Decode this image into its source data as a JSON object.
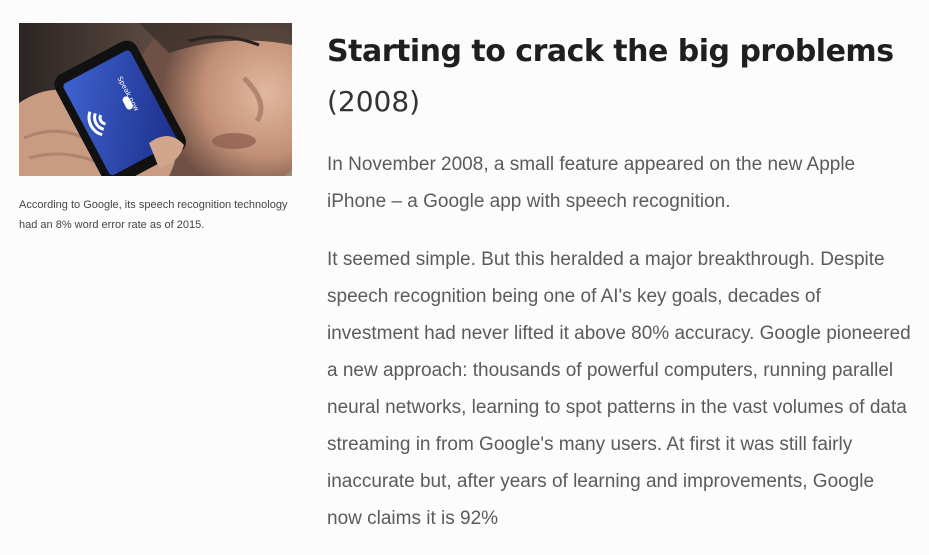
{
  "figure": {
    "caption": "According to Google, its speech recognition technology had an 8% word error rate as of 2015.",
    "phone_screen_text": "Speak now"
  },
  "article": {
    "title": "Starting to crack the big problems",
    "year": "(2008)",
    "paragraphs": [
      "In November 2008, a small feature appeared on the new Apple iPhone – a Google app with speech recognition.",
      "It seemed simple. But this heralded a major breakthrough. Despite speech recognition being one of AI's key goals, decades of investment had never lifted it above 80% accuracy. Google pioneered a new approach: thousands of powerful computers, running parallel neural networks, learning to spot patterns in the vast volumes of data streaming in from Google's many users. At first it was still fairly inaccurate but, after years of learning and improvements, Google now claims it is 92%"
    ]
  }
}
